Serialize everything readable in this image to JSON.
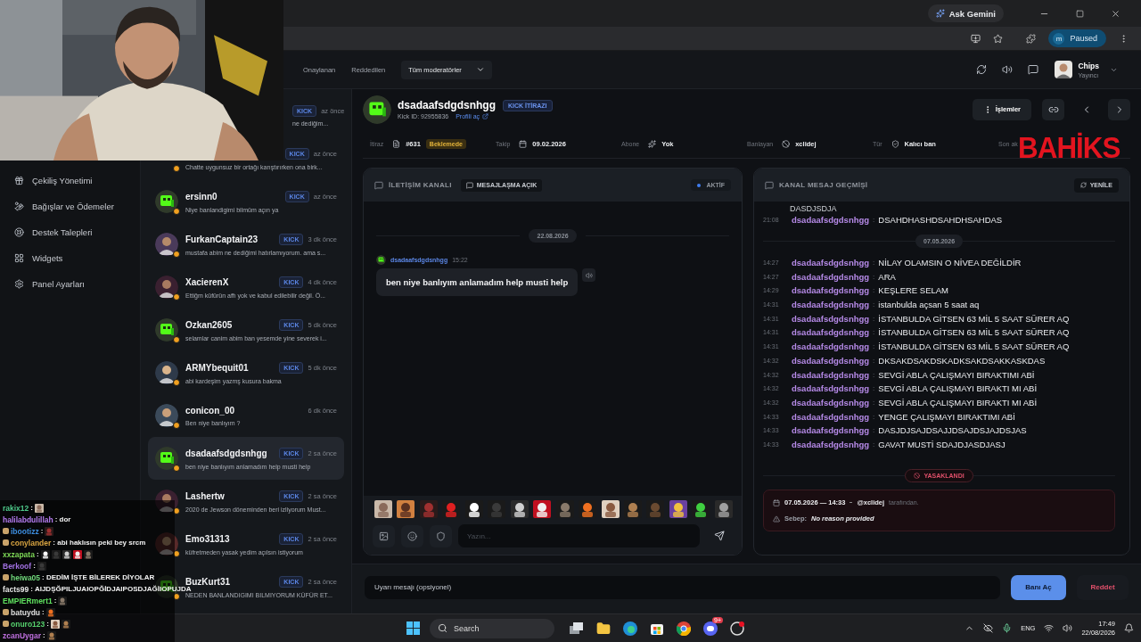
{
  "browser": {
    "ask_button": "Ask Gemini",
    "profile_initial": "m",
    "profile_status": "Paused"
  },
  "topbar": {
    "tabs": [
      {
        "label": "Onaylanan",
        "selected": false
      },
      {
        "label": "Reddedilen",
        "selected": false
      }
    ],
    "moderator_filter": "Tüm moderatörler",
    "user": {
      "name": "Chips",
      "role": "Yayıncı"
    }
  },
  "sidebar": {
    "items": [
      {
        "label": "Çekiliş Yönetimi"
      },
      {
        "label": "Bağışlar ve Ödemeler"
      },
      {
        "label": "Destek Talepleri"
      },
      {
        "label": "Widgets"
      },
      {
        "label": "Panel Ayarları"
      }
    ]
  },
  "appeals": [
    {
      "kind": "clipped",
      "platform": "KICK",
      "time": "az önce",
      "message": "ne dediğim...",
      "selected": false
    },
    {
      "kind": "row",
      "platform": "KICK",
      "time": "az önce",
      "message": "Chatte uygunsuz bir ortağı karıştırırken ona birk...",
      "selected": false
    },
    {
      "kind": "row",
      "avatar": {
        "kind": "default"
      },
      "name": "ersinn0",
      "platform": "KICK",
      "time": "az önce",
      "message": "Niye banlandigimi bilmüm açın ya",
      "selected": false
    },
    {
      "kind": "row",
      "name": "FurkanCaptain23",
      "platform": "KICK",
      "time": "3 dk önce",
      "message": "mustafa abim ne dediğimi hatırlamıyorum. ama s...",
      "selected": false
    },
    {
      "kind": "row",
      "name": "XacierenX",
      "platform": "KICK",
      "time": "4 dk önce",
      "message": "Ettiğm küfürün affı yok ve kabul edilebilir değil. Ö...",
      "selected": false
    },
    {
      "kind": "row",
      "avatar": {
        "kind": "default"
      },
      "name": "Ozkan2605",
      "platform": "KICK",
      "time": "5 dk önce",
      "message": "selamlar canim abim ban yesemde yine severek i...",
      "selected": false
    },
    {
      "kind": "row",
      "name": "ARMYbequit01",
      "platform": "KICK",
      "time": "5 dk önce",
      "message": "abi kardeşim yazmş kusura bakma",
      "selected": false
    },
    {
      "kind": "row",
      "name": "conicon_00",
      "time": "6 dk önce",
      "message": "Ben niye banlıyım ?",
      "selected": false
    },
    {
      "kind": "row",
      "avatar": {
        "kind": "default"
      },
      "name": "dsadaafsdgdsnhgg",
      "platform": "KICK",
      "time": "2 sa önce",
      "message": "ben niye banlıyım anlamadım help musti help",
      "selected": true
    },
    {
      "kind": "row",
      "name": "Lashertw",
      "platform": "KICK",
      "time": "2 sa önce",
      "message": "2020 de Jewson döneminden beri izliyorum Must...",
      "selected": false
    },
    {
      "kind": "row",
      "name": "Emo31313",
      "platform": "KICK",
      "time": "2 sa önce",
      "message": "küfretmeden yasak yedim açılsın istiyorum",
      "selected": false
    },
    {
      "kind": "row",
      "avatar": {
        "kind": "default"
      },
      "name": "BuzKurt31",
      "platform": "KICK",
      "time": "2 sa önce",
      "message": "NEDEN BANLANDIGIMI BILMIYORUM KÜFÜR ET...",
      "selected": false
    }
  ],
  "detail": {
    "name": "dsadaafsdgdsnhgg",
    "badge": "KICK İTİRAZI",
    "kick_id": "Kick ID: 92955836",
    "profile_link": "Profili aç",
    "actions_button": "İşlemler",
    "info": [
      {
        "label": "İtiraz",
        "value": "#631",
        "status": "Beklemede"
      },
      {
        "label": "Takip",
        "value": "09.02.2026"
      },
      {
        "label": "Abone",
        "value": "Yok"
      },
      {
        "label": "Banlayan",
        "value": "xclidej"
      },
      {
        "label": "Tür",
        "value": "Kalıcı ban"
      },
      {
        "label": "Son ak"
      }
    ]
  },
  "channel": {
    "title": "İLETİŞİM KANALI",
    "messaging": "MESAJLAŞMA AÇIK",
    "status": "AKTİF",
    "date": "22.08.2026",
    "messages": [
      {
        "user": "dsadaafsdgdsnhgg",
        "time": "15:22",
        "text": "ben niye banlıyım anlamadım help musti help"
      }
    ],
    "input": {
      "placeholder": "Yazın..."
    }
  },
  "history": {
    "title": "KANAL MESAJ GEÇMİŞİ",
    "refresh": "YENİLE",
    "rows": [
      {
        "kind": "continuation",
        "text": "DASDJSDJA"
      },
      {
        "kind": "message",
        "time": "21:08",
        "user": "dsadaafsdgdsnhgg",
        "sep": ":",
        "text": "DSAHDHASHDSAHDHSAHDAS"
      },
      {
        "kind": "date",
        "text": "07.05.2026"
      },
      {
        "kind": "message",
        "time": "14:27",
        "user": "dsadaafsdgdsnhgg",
        "sep": ":",
        "text": "NİLAY OLAMSIN O NİVEA DEĞİLDİR"
      },
      {
        "kind": "message",
        "time": "14:27",
        "user": "dsadaafsdgdsnhgg",
        "sep": ":",
        "text": "ARA"
      },
      {
        "kind": "message",
        "time": "14:29",
        "user": "dsadaafsdgdsnhgg",
        "sep": ":",
        "text": "KEŞLERE SELAM"
      },
      {
        "kind": "message",
        "time": "14:31",
        "user": "dsadaafsdgdsnhgg",
        "sep": ":",
        "text": "istanbulda açsan 5 saat aq"
      },
      {
        "kind": "message",
        "time": "14:31",
        "user": "dsadaafsdgdsnhgg",
        "sep": ":",
        "text": "İSTANBULDA GİTSEN 63 MİL 5 SAAT SÜRER AQ"
      },
      {
        "kind": "message",
        "time": "14:31",
        "user": "dsadaafsdgdsnhgg",
        "sep": ":",
        "text": "İSTANBULDA GİTSEN 63 MİL 5 SAAT SÜRER AQ"
      },
      {
        "kind": "message",
        "time": "14:31",
        "user": "dsadaafsdgdsnhgg",
        "sep": ":",
        "text": "İSTANBULDA GİTSEN 63 MİL 5 SAAT SÜRER AQ"
      },
      {
        "kind": "message",
        "time": "14:32",
        "user": "dsadaafsdgdsnhgg",
        "sep": ":",
        "text": "DKSAKDSAKDSKADKSAKDSAKKASKDAS"
      },
      {
        "kind": "message",
        "time": "14:32",
        "user": "dsadaafsdgdsnhgg",
        "sep": ":",
        "text": "SEVGİ ABLA ÇALIŞMAYI BIRAKTIMI ABİ"
      },
      {
        "kind": "message",
        "time": "14:32",
        "user": "dsadaafsdgdsnhgg",
        "sep": ":",
        "text": "SEVGİ ABLA ÇALIŞMAYI BIRAKTI MI ABİ"
      },
      {
        "kind": "message",
        "time": "14:32",
        "user": "dsadaafsdgdsnhgg",
        "sep": ":",
        "text": "SEVGİ ABLA ÇALIŞMAYI BIRAKTI MI ABİ"
      },
      {
        "kind": "message",
        "time": "14:33",
        "user": "dsadaafsdgdsnhgg",
        "sep": ":",
        "text": "YENGE ÇALIŞMAYI BIRAKTIMI ABİ"
      },
      {
        "kind": "message",
        "time": "14:33",
        "user": "dsadaafsdgdsnhgg",
        "sep": ":",
        "text": "DASJDJSAJDSAJJDSAJDSJAJDSJAS"
      },
      {
        "kind": "message",
        "time": "14:33",
        "user": "dsadaafsdgdsnhgg",
        "sep": ":",
        "text": "GAVAT MUSTİ SDAJDJASDJASJ"
      }
    ],
    "ban_label": "YASAKLANDI",
    "ban": {
      "when": "07.05.2026 — 14:33",
      "by": "@xclidej",
      "by_suffix": "tarafından.",
      "reason_label": "Sebep:",
      "reason": "No reason provided"
    }
  },
  "footer": {
    "warning": {
      "placeholder": "Uyarı mesajı (opsiyonel)"
    },
    "approve": "Banı Aç",
    "reject": "Reddet"
  },
  "stream_chat": [
    {
      "user": "rakix12",
      "color": "#4ec98a",
      "badge": false,
      "text": ":"
    },
    {
      "user": "halilabdulillah",
      "color": "#b57cf0",
      "badge": false,
      "text": ": dor"
    },
    {
      "user": "ibootizz",
      "color": "#3d8ee0",
      "badge": true,
      "text": ":"
    },
    {
      "user": "conylander",
      "color": "#d9a441",
      "badge": true,
      "text": ": abi haklısın peki bey srcm"
    },
    {
      "user": "xxzapata",
      "color": "#7ed957",
      "badge": false,
      "text": ":"
    },
    {
      "user": "Berkoof",
      "color": "#a070e0",
      "badge": false,
      "text": ":"
    },
    {
      "user": "heiwa05",
      "color": "#6fd67a",
      "badge": true,
      "text": ": DEDİM İŞTE BİLEREK DİYOLAR"
    },
    {
      "user": "facts99",
      "color": "#e6e6e6",
      "badge": false,
      "text": ": AIJDŞĞPILJUAIOPĞİDJAIPOSDJAĞİIOPUJDA"
    },
    {
      "user": "EMPIERmert1",
      "color": "#5fe05f",
      "badge": false,
      "text": ":"
    },
    {
      "user": "batuydu",
      "color": "#e0e0e0",
      "badge": true,
      "text": ":"
    },
    {
      "user": "onuro123",
      "color": "#56d16d",
      "badge": true,
      "text": ":"
    },
    {
      "user": "zcanUygar",
      "color": "#c070e0",
      "badge": false,
      "text": ":"
    }
  ],
  "logo": "BAHİKS",
  "taskbar": {
    "search": "Search",
    "discord_badge": "9+",
    "language": "ENG",
    "time": "17:49",
    "date": "22/08/2026"
  }
}
